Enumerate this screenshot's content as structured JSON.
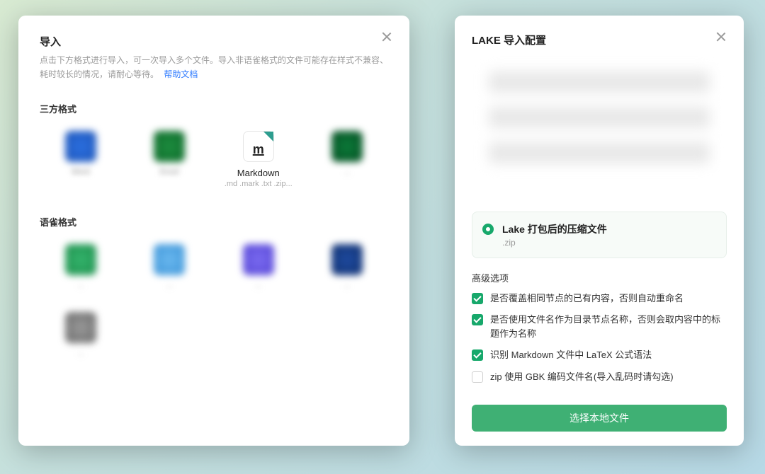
{
  "left": {
    "title": "导入",
    "desc": "点击下方格式进行导入，可一次导入多个文件。导入非语雀格式的文件可能存在样式不兼容、耗时较长的情况，请耐心等待。",
    "help_link": "帮助文档",
    "section_thirdparty": "三方格式",
    "markdown": {
      "name": "Markdown",
      "ext": ".md .mark .txt .zip..."
    },
    "section_yuque": "语雀格式"
  },
  "right": {
    "title": "LAKE 导入配置",
    "option": {
      "name": "Lake 打包后的压缩文件",
      "sub": ".zip"
    },
    "adv_heading": "高级选项",
    "checks": [
      {
        "label": "是否覆盖相同节点的已有内容，否则自动重命名",
        "checked": true
      },
      {
        "label": "是否使用文件名作为目录节点名称，否则会取内容中的标题作为名称",
        "checked": true
      },
      {
        "label": "识别 Markdown 文件中 LaTeX 公式语法",
        "checked": true
      },
      {
        "label": "zip 使用 GBK 编码文件名(导入乱码时请勾选)",
        "checked": false
      }
    ],
    "primary": "选择本地文件"
  }
}
